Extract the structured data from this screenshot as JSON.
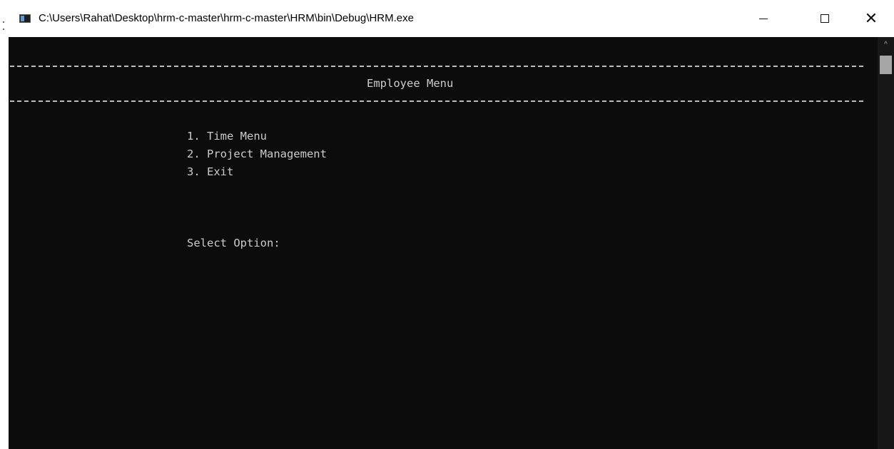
{
  "window": {
    "title": "C:\\Users\\Rahat\\Desktop\\hrm-c-master\\hrm-c-master\\HRM\\bin\\Debug\\HRM.exe",
    "minimize_icon": "minimize-icon",
    "maximize_icon": "maximize-icon",
    "close_label": "✕",
    "close_icon": "close-icon"
  },
  "console": {
    "heading": "Employee Menu",
    "menu_items": [
      "1. Time Menu",
      "2. Project Management",
      "3. Exit"
    ],
    "prompt": "Select Option:",
    "background_color": "#0c0c0c",
    "text_color": "#cccccc"
  },
  "scrollbar": {
    "up_arrow": "^"
  }
}
